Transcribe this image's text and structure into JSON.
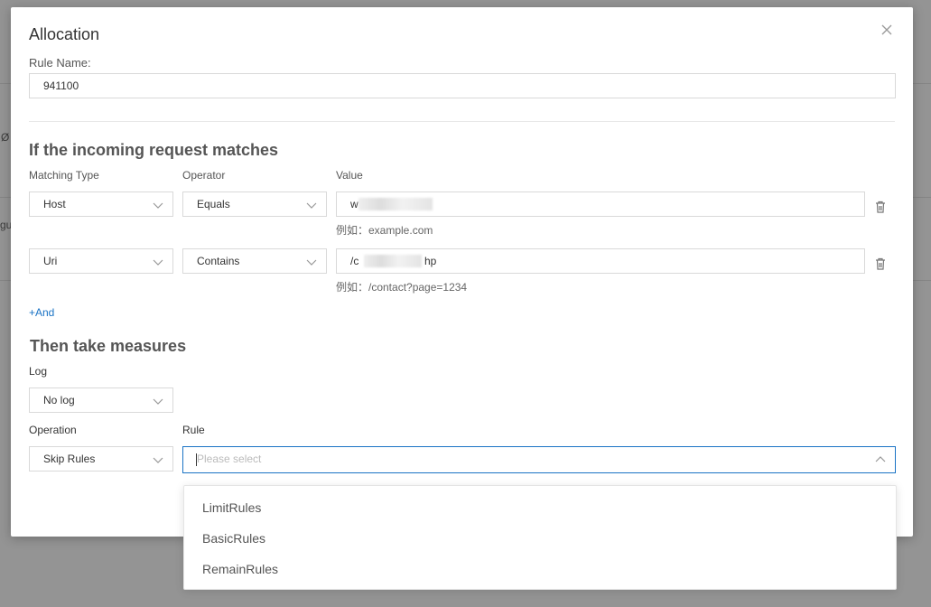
{
  "background": {
    "side_texts": [
      "Ø",
      "gu"
    ]
  },
  "modal": {
    "title": "Allocation",
    "rule_name": {
      "label": "Rule Name:",
      "value": "941100"
    },
    "match_section": {
      "title": "If the incoming request matches",
      "headers": {
        "matching_type": "Matching Type",
        "operator": "Operator",
        "value": "Value"
      },
      "rows": [
        {
          "matching_type": "Host",
          "operator": "Equals",
          "value": "w",
          "hint": "例如：example.com"
        },
        {
          "matching_type": "Uri",
          "operator": "Contains",
          "value": "/c",
          "value_tail": "hp",
          "hint": "例如：/contact?page=1234"
        }
      ],
      "add_label": "+And"
    },
    "measure_section": {
      "title": "Then take measures",
      "log_label": "Log",
      "log_value": "No log",
      "operation_label": "Operation",
      "operation_value": "Skip Rules",
      "rule_label": "Rule",
      "rule_placeholder": "Please select",
      "rule_options": [
        "LimitRules",
        "BasicRules",
        "RemainRules"
      ]
    }
  },
  "colors": {
    "accent": "#1a73c5",
    "overlay": "rgba(0,0,0,0.42)"
  }
}
